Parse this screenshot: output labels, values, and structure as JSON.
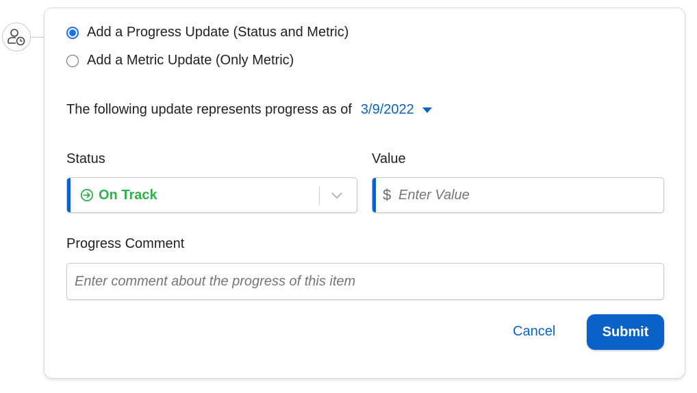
{
  "update_type": {
    "options": [
      {
        "label": "Add a Progress Update (Status and Metric)",
        "selected": true
      },
      {
        "label": "Add a Metric Update (Only Metric)",
        "selected": false
      }
    ]
  },
  "as_of": {
    "text": "The following update represents progress as of",
    "date": "3/9/2022"
  },
  "status": {
    "label": "Status",
    "value": "On Track",
    "value_color": "#2db24a",
    "icon": "arrow-circle-right-icon"
  },
  "value": {
    "label": "Value",
    "currency_symbol": "$",
    "placeholder": "Enter Value"
  },
  "comment": {
    "label": "Progress Comment",
    "placeholder": "Enter comment about the progress of this item"
  },
  "actions": {
    "cancel_label": "Cancel",
    "submit_label": "Submit"
  },
  "colors": {
    "accent": "#0a62c9",
    "radio_selected": "#1a73e8"
  }
}
